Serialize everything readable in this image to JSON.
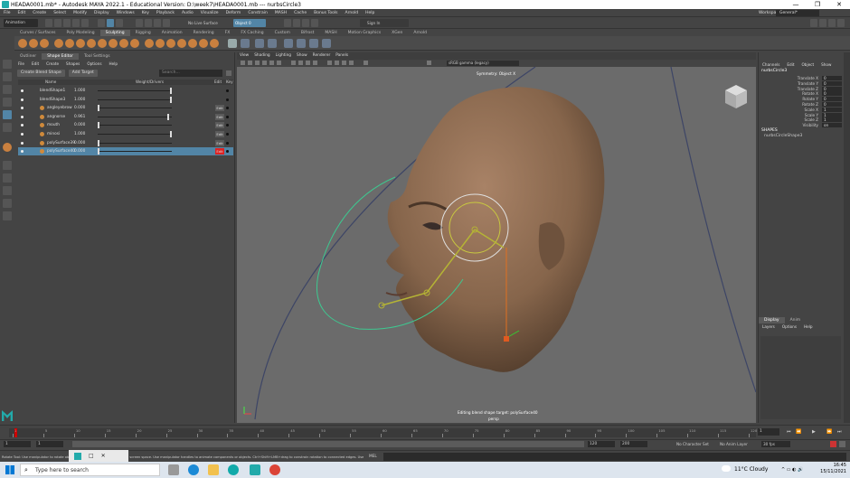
{
  "window": {
    "title": "HEADA0001.mb* - Autodesk MAYA 2022.1 - Educational Version: D:\\week7\\HEADA0001.mb --- nurbsCircle3",
    "controls": [
      "—",
      "❐",
      "✕"
    ]
  },
  "menubar": [
    "File",
    "Edit",
    "Create",
    "Select",
    "Modify",
    "Display",
    "Windows",
    "Key",
    "Playback",
    "Audio",
    "Visualize",
    "Deform",
    "Constrain",
    "MASH",
    "Cache",
    "Bonus Tools",
    "Arnold",
    "Help"
  ],
  "workspace": {
    "label": "Workspace:",
    "value": "General*"
  },
  "status": {
    "mode": "Animation",
    "no_live": "No Live Surface",
    "object": "Object 0",
    "sign_in": "Sign In"
  },
  "shelf_tabs": [
    "Curves / Surfaces",
    "Poly Modeling",
    "Sculpting",
    "Rigging",
    "Animation",
    "Rendering",
    "FX",
    "FX Caching",
    "Custom",
    "Bifrost",
    "MASH",
    "Motion Graphics",
    "XGen",
    "Arnold"
  ],
  "shelf_active": "Sculpting",
  "shape_editor": {
    "tabs": [
      "Outliner",
      "Shape Editor",
      "Tool Settings"
    ],
    "menus": [
      "File",
      "Edit",
      "Create",
      "Shapes",
      "Options",
      "Help"
    ],
    "create_button": "Create Blend Shape",
    "add_target_button": "Add Target",
    "search_placeholder": "Search...",
    "header": {
      "name": "Name",
      "weight": "Weight/Drivers",
      "edit": "Edit",
      "key": "Key"
    },
    "rows": [
      {
        "name": "blendShape1",
        "value": "1.000",
        "knob": 1.0,
        "edit": ""
      },
      {
        "name": "blendShape3",
        "value": "1.000",
        "knob": 1.0,
        "edit": ""
      },
      {
        "name": "angleyebrow",
        "value": "0.000",
        "knob": 0.0,
        "edit": "Edit"
      },
      {
        "name": "angnorse",
        "value": "0.961",
        "knob": 0.961,
        "edit": "Edit"
      },
      {
        "name": "mouth",
        "value": "0.000",
        "knob": 0.0,
        "edit": "Edit"
      },
      {
        "name": "minosi",
        "value": "1.000",
        "knob": 1.0,
        "edit": "Edit"
      },
      {
        "name": "polySurface39",
        "value": "0.000",
        "knob": 0.0,
        "edit": "Edit"
      },
      {
        "name": "polySurface40",
        "value": "0.000",
        "knob": 0.0,
        "edit": "Edit"
      }
    ]
  },
  "viewport": {
    "menus": [
      "View",
      "Shading",
      "Lighting",
      "Show",
      "Renderer",
      "Panels"
    ],
    "colorspace": "sRGB gamma (legacy)",
    "symmetry": "Symmetry: Object X",
    "editing_msg": "Editing blend shape target: polySurface40",
    "camera": "persp",
    "colors": {
      "bg": "#6b6b6b",
      "skin": "#8a6a50",
      "circle": "#3ec890",
      "bone": "#b5b435",
      "joint_orange": "#e07020"
    }
  },
  "channel_box": {
    "menus": [
      "Channels",
      "Edit",
      "Object",
      "Show"
    ],
    "object": "nurbsCircle3",
    "attrs": [
      {
        "label": "Translate X",
        "value": "0"
      },
      {
        "label": "Translate Y",
        "value": "0"
      },
      {
        "label": "Translate Z",
        "value": "0"
      },
      {
        "label": "Rotate X",
        "value": "0"
      },
      {
        "label": "Rotate Y",
        "value": "0"
      },
      {
        "label": "Rotate Z",
        "value": "0"
      },
      {
        "label": "Scale X",
        "value": "1"
      },
      {
        "label": "Scale Y",
        "value": "1"
      },
      {
        "label": "Scale Z",
        "value": "1"
      },
      {
        "label": "Visibility",
        "value": "on"
      }
    ],
    "shapes_label": "SHAPES",
    "shape": "nurbsCircleShape3",
    "layer_tabs": [
      "Display",
      "Anim"
    ],
    "layer_menus": [
      "Layers",
      "Options",
      "Help"
    ]
  },
  "timeline": {
    "ticks": [
      "1",
      "5",
      "10",
      "15",
      "20",
      "25",
      "30",
      "35",
      "40",
      "45",
      "50",
      "55",
      "60",
      "65",
      "70",
      "75",
      "80",
      "85",
      "90",
      "95",
      "100",
      "105",
      "110",
      "115",
      "120"
    ],
    "current": "1",
    "frame_field": "1"
  },
  "range": {
    "start": "1",
    "start2": "1",
    "end": "120",
    "end2": "200",
    "fps": "30 fps",
    "char_set": "No Character Set",
    "anim_layer": "No Anim Layer"
  },
  "helpline": {
    "text": "Rotate Tool: Use manipulator to rotate object(s). Ctrl+middle-drag to rotate in screen space. Use manipulator handles to animate components or objects. Ctrl+Shift+LMB+drag to constrain rotation to connected edges. Use D or INSERT to change the pivot",
    "lang": "MEL"
  },
  "taskbar": {
    "search": "Type here to search",
    "weather": "11°C  Cloudy",
    "time": "16:45",
    "date": "15/11/2021"
  }
}
